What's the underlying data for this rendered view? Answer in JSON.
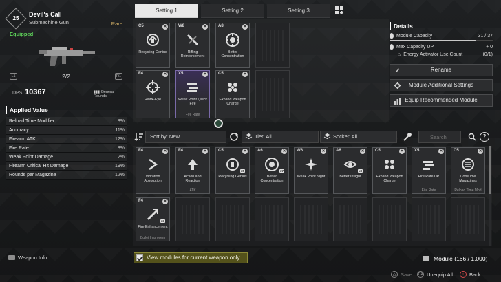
{
  "weapon": {
    "level": "25",
    "name": "Devil's Call",
    "type": "Submachine Gun",
    "rarity": "Rare",
    "status": "Equipped",
    "slots": "2/2",
    "key_left": "L1",
    "key_right": "R1",
    "dps_label": "DPS",
    "dps_value": "10367",
    "ammo_type": "General Rounds"
  },
  "applied": {
    "title": "Applied Value",
    "stats": [
      {
        "label": "Reload Time Modifier",
        "value": "8%"
      },
      {
        "label": "Accuracy",
        "value": "11%"
      },
      {
        "label": "Firearm ATK",
        "value": "12%"
      },
      {
        "label": "Fire Rate",
        "value": "8%"
      },
      {
        "label": "Weak Point Damage",
        "value": "2%"
      },
      {
        "label": "Firearm Critical Hit Damage",
        "value": "19%"
      },
      {
        "label": "Rounds per Magazine",
        "value": "12%"
      }
    ]
  },
  "weapon_info_label": "Weapon Info",
  "tabs": [
    "Setting 1",
    "Setting 2",
    "Setting 3"
  ],
  "equipped": [
    {
      "cap": "C5",
      "name": "Recycling Genius",
      "sub": "",
      "style": "normal"
    },
    {
      "cap": "W8",
      "name": "Rifling Reinforcement",
      "sub": "",
      "style": "normal"
    },
    {
      "cap": "A8",
      "name": "Better Concentration",
      "sub": "",
      "style": "normal"
    },
    {
      "cap": "F4",
      "name": "Hawk-Eye",
      "sub": "",
      "style": "normal"
    },
    {
      "cap": "X5",
      "name": "Weak Point Quick Fire",
      "sub": "Fire Rate",
      "style": "purple"
    },
    {
      "cap": "C5",
      "name": "Expand Weapon Charge",
      "sub": "",
      "style": "normal"
    }
  ],
  "details": {
    "title": "Details",
    "capacity_label": "Module Capacity",
    "capacity_value": "31 / 37",
    "capacity_fraction": 0.84,
    "max_cap_label": "Max Capacity UP",
    "max_cap_value": "+ 0",
    "activator_label": "Energy Activator Use Count",
    "activator_value": "(0/1)",
    "rename": "Rename",
    "additional": "Module Additional Settings",
    "recommend": "Equip Recommended Module"
  },
  "filter": {
    "sort": "Sort by: New",
    "tier": "Tier: All",
    "socket": "Socket: All",
    "search_placeholder": "Search"
  },
  "inventory": [
    {
      "cap": "F4",
      "name": "Vibration Absorption",
      "sub": "",
      "count": "",
      "style": "normal"
    },
    {
      "cap": "F4",
      "name": "Action and Reaction",
      "sub": "ATK",
      "count": "",
      "style": "normal"
    },
    {
      "cap": "C5",
      "name": "Recycling Genius",
      "sub": "",
      "count": "x5",
      "style": "normal"
    },
    {
      "cap": "A6",
      "name": "Better Concentration",
      "sub": "",
      "count": "x7",
      "style": "normal"
    },
    {
      "cap": "W6",
      "name": "Weak Point Sight",
      "sub": "",
      "count": "",
      "style": "normal"
    },
    {
      "cap": "A6",
      "name": "Better Insight",
      "sub": "",
      "count": "x3",
      "style": "normal"
    },
    {
      "cap": "C5",
      "name": "Expand Weapon Charge",
      "sub": "",
      "count": "",
      "style": "normal"
    },
    {
      "cap": "X5",
      "name": "Fire Rate UP",
      "sub": "Fire Rate",
      "count": "",
      "style": "normal"
    },
    {
      "cap": "C5",
      "name": "Consume Magazines",
      "sub": "Reload Time Mod",
      "count": "",
      "style": "normal"
    },
    {
      "cap": "F4",
      "name": "Fire Enhancement",
      "sub": "Bullet Improvem",
      "count": "x3",
      "style": "normal"
    }
  ],
  "view_check": "View modules for current weapon only",
  "module_count": "Module (166 / 1,000)",
  "footer": {
    "save": "Save",
    "save_key": "△",
    "unequip": "Unequip All",
    "unequip_key": "R3",
    "back": "Back",
    "back_key": "○"
  },
  "colors": {
    "rare": "#d8b468",
    "equipped": "#5fd35a",
    "check_bg": "#54521b"
  }
}
